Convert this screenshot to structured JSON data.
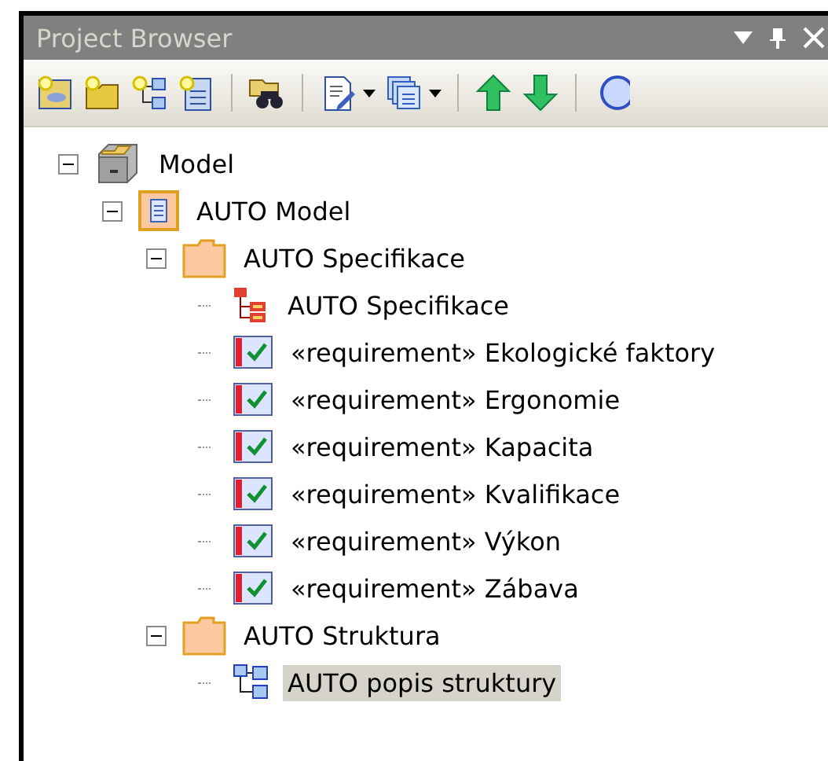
{
  "panel": {
    "title": "Project Browser"
  },
  "toolbar": [
    {
      "kind": "new-model"
    },
    {
      "kind": "new-folder"
    },
    {
      "kind": "new-diagram"
    },
    {
      "kind": "new-element"
    },
    {
      "kind": "separator"
    },
    {
      "kind": "find"
    },
    {
      "kind": "separator"
    },
    {
      "kind": "edit",
      "dropdown": true
    },
    {
      "kind": "windows",
      "dropdown": true
    },
    {
      "kind": "separator"
    },
    {
      "kind": "up"
    },
    {
      "kind": "down"
    },
    {
      "kind": "separator"
    },
    {
      "kind": "help"
    }
  ],
  "tree": [
    {
      "kind": "model",
      "label": "Model",
      "expanded": true,
      "selected": false,
      "children": [
        {
          "kind": "package",
          "label": "AUTO Model",
          "expanded": true,
          "selected": false,
          "children": [
            {
              "kind": "folder",
              "label": "AUTO Specifikace",
              "expanded": true,
              "selected": false,
              "children": [
                {
                  "kind": "requirement-diagram",
                  "label": "AUTO Specifikace",
                  "selected": false
                },
                {
                  "kind": "requirement",
                  "label": "«requirement» Ekologické faktory",
                  "selected": false
                },
                {
                  "kind": "requirement",
                  "label": "«requirement» Ergonomie",
                  "selected": false
                },
                {
                  "kind": "requirement",
                  "label": "«requirement» Kapacita",
                  "selected": false
                },
                {
                  "kind": "requirement",
                  "label": "«requirement» Kvalifikace",
                  "selected": false
                },
                {
                  "kind": "requirement",
                  "label": "«requirement» Výkon",
                  "selected": false
                },
                {
                  "kind": "requirement",
                  "label": "«requirement» Zábava",
                  "selected": false
                }
              ]
            },
            {
              "kind": "folder",
              "label": "AUTO Struktura",
              "expanded": true,
              "selected": false,
              "children": [
                {
                  "kind": "structure-diagram",
                  "label": "AUTO popis struktury",
                  "selected": true
                }
              ]
            }
          ]
        }
      ]
    }
  ]
}
